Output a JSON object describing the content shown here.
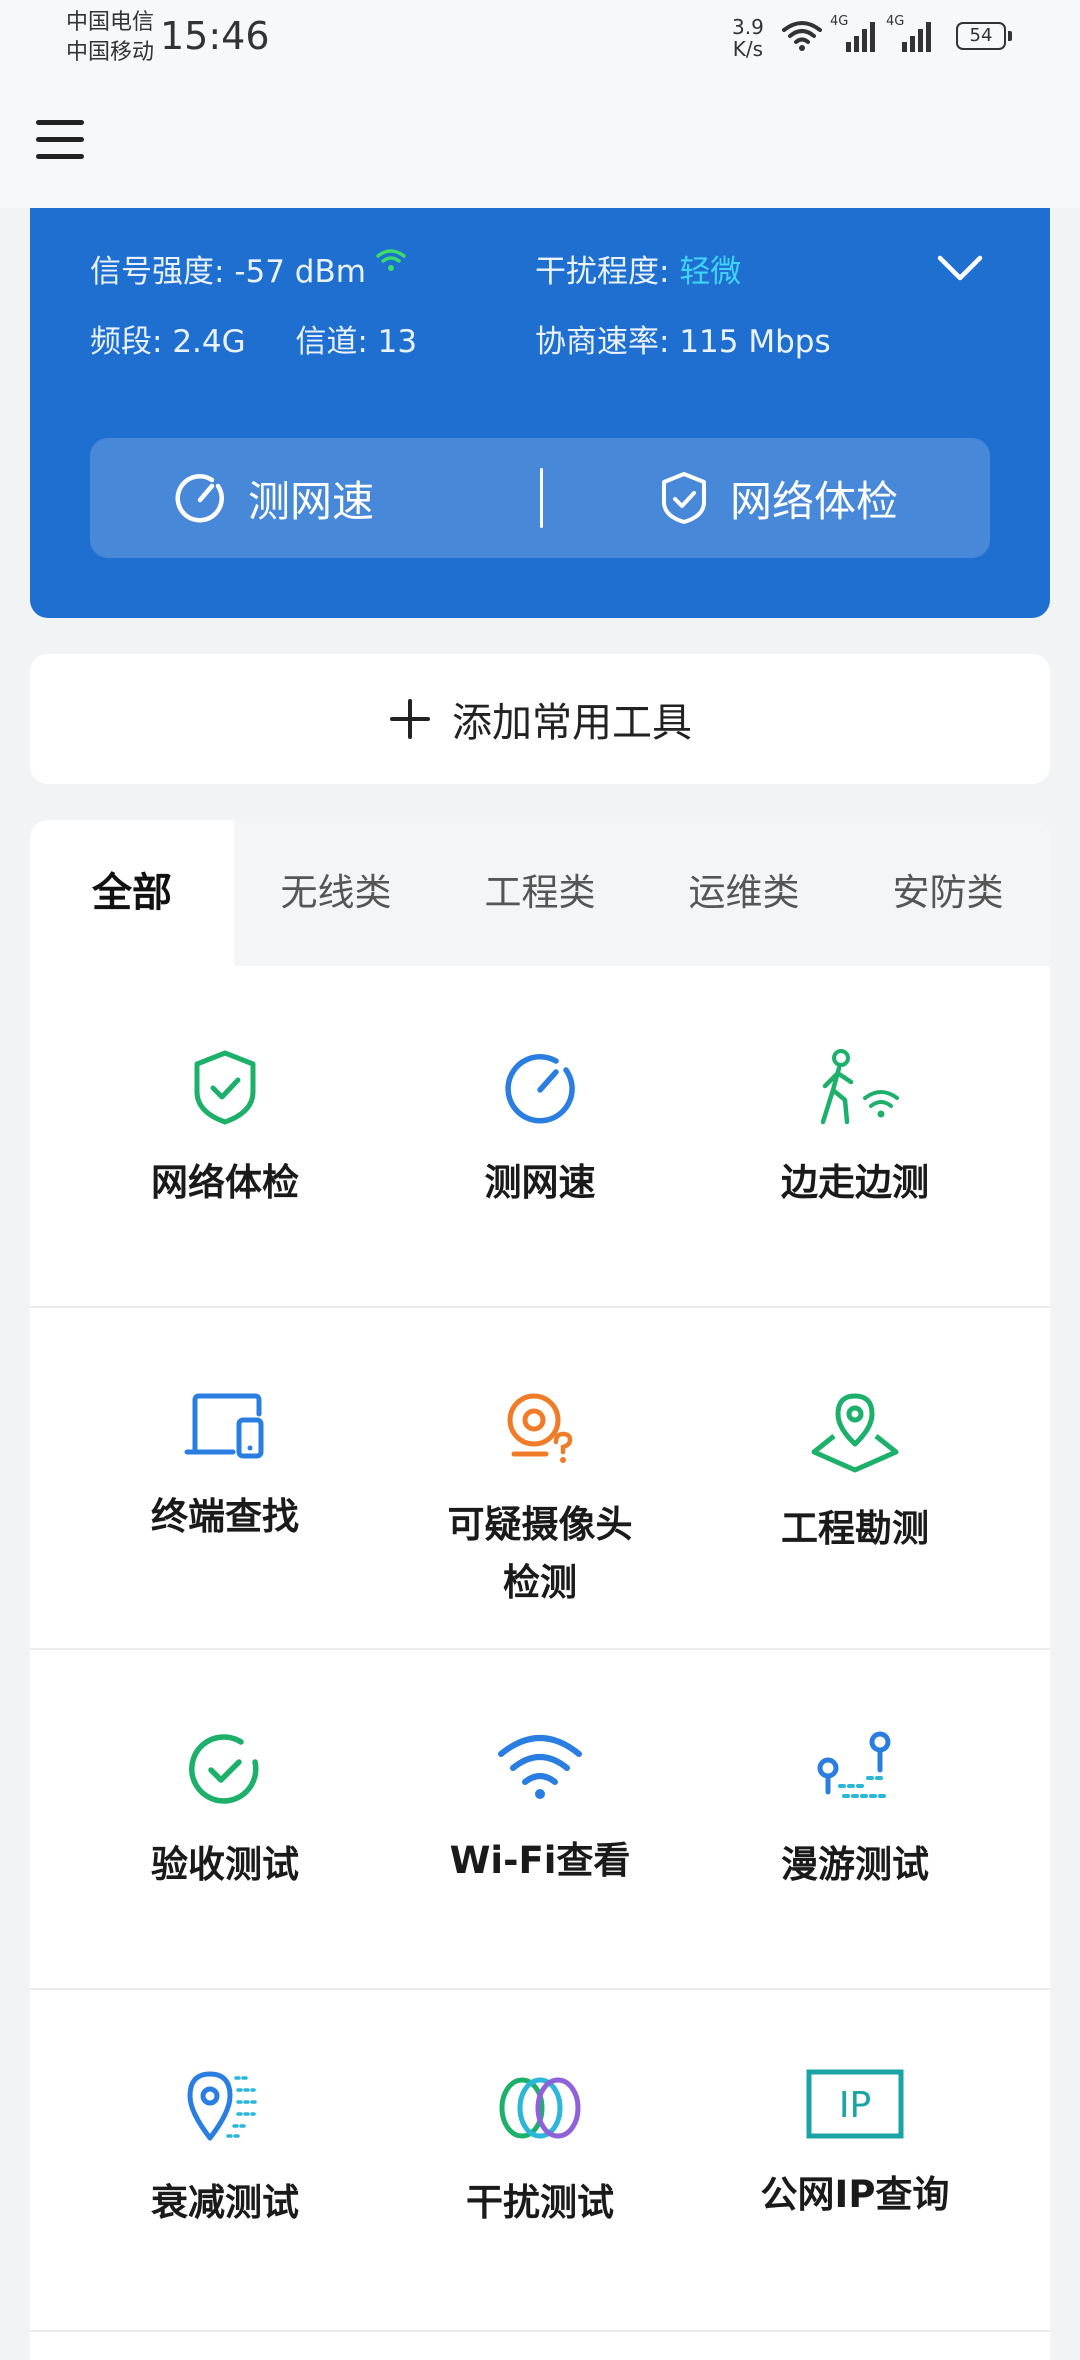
{
  "status_bar": {
    "carrier1": "中国电信",
    "carrier2": "中国移动",
    "time": "15:46",
    "net_speed_value": "3.9",
    "net_speed_unit": "K/s",
    "signal1_tech": "4G",
    "signal2_tech": "4G",
    "battery": "54"
  },
  "wifi_info": {
    "signal_label": "信号强度:",
    "signal_value": "-57 dBm",
    "interference_label": "干扰程度:",
    "interference_value": "轻微",
    "band_label": "频段:",
    "band_value": "2.4G",
    "channel_label": "信道:",
    "channel_value": "13",
    "rate_label": "协商速率:",
    "rate_value": "115 Mbps",
    "accent_color": "#41d3ff",
    "card_color": "#1f6fd0"
  },
  "actions": {
    "speed_test": "测网速",
    "network_check": "网络体检"
  },
  "add_tool": {
    "label": "添加常用工具"
  },
  "tabs": [
    "全部",
    "无线类",
    "工程类",
    "运维类",
    "安防类"
  ],
  "tools": [
    {
      "label": "网络体检",
      "icon": "shield-check-icon"
    },
    {
      "label": "测网速",
      "icon": "speedometer-icon"
    },
    {
      "label": "边走边测",
      "icon": "walking-wifi-icon"
    },
    {
      "label": "终端查找",
      "icon": "devices-icon"
    },
    {
      "label": "可疑摄像头",
      "label2": "检测",
      "icon": "camera-question-icon"
    },
    {
      "label": "工程勘测",
      "icon": "map-pin-icon"
    },
    {
      "label": "验收测试",
      "icon": "check-circle-icon"
    },
    {
      "label": "Wi-Fi查看",
      "icon": "wifi-icon"
    },
    {
      "label": "漫游测试",
      "icon": "roaming-icon"
    },
    {
      "label": "衰减测试",
      "icon": "attenuation-pin-icon"
    },
    {
      "label": "干扰测试",
      "icon": "interference-rings-icon"
    },
    {
      "label": "公网IP查询",
      "icon": "ip-box-icon"
    }
  ],
  "ip_icon_text": "IP"
}
